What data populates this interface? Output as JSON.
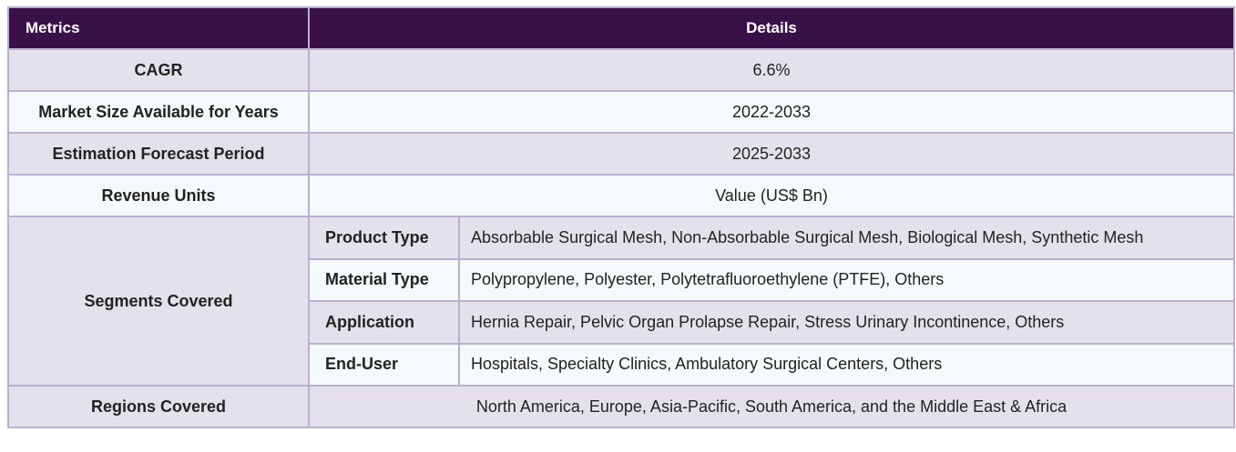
{
  "table": {
    "headers": {
      "metrics": "Metrics",
      "details": "Details"
    },
    "rows": [
      {
        "metric": "CAGR",
        "value": "6.6%"
      },
      {
        "metric": "Market Size Available for Years",
        "value": "2022-2033"
      },
      {
        "metric": "Estimation Forecast Period",
        "value": "2025-2033"
      },
      {
        "metric": "Revenue Units",
        "value": "Value (US$ Bn)"
      }
    ],
    "segments": {
      "label": "Segments Covered",
      "items": [
        {
          "name": "Product Type",
          "value": "Absorbable Surgical Mesh, Non-Absorbable Surgical Mesh, Biological Mesh, Synthetic Mesh"
        },
        {
          "name": "Material Type",
          "value": "Polypropylene, Polyester, Polytetrafluoroethylene (PTFE), Others"
        },
        {
          "name": "Application",
          "value": "Hernia Repair, Pelvic Organ Prolapse Repair, Stress Urinary Incontinence, Others"
        },
        {
          "name": "End-User",
          "value": "Hospitals, Specialty Clinics, Ambulatory Surgical Centers, Others"
        }
      ]
    },
    "regions": {
      "metric": "Regions Covered",
      "value": "North America, Europe, Asia-Pacific, South America, and the Middle East & Africa"
    }
  },
  "colors": {
    "header_bg": "#3a1049",
    "row_shaded": "#e4e1ec",
    "row_light": "#f4f9fb",
    "border": "#b9b0cf"
  }
}
